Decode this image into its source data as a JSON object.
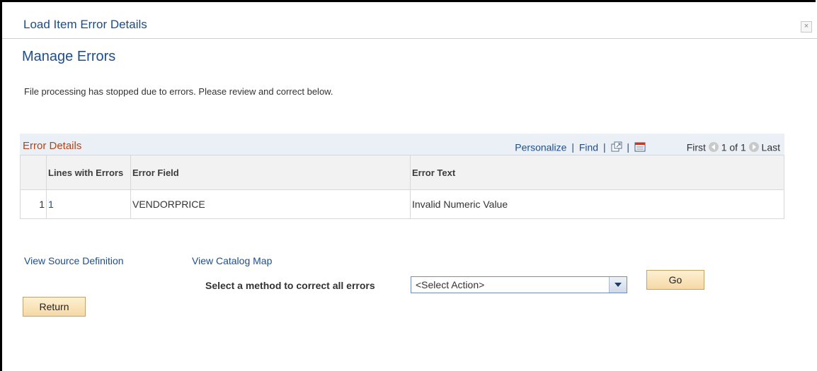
{
  "dialog": {
    "title": "Load Item Error Details",
    "close_label": "×"
  },
  "page": {
    "title": "Manage Errors",
    "message": "File processing has stopped due to errors. Please review and correct below."
  },
  "grid": {
    "title": "Error Details",
    "nav": {
      "personalize": "Personalize",
      "find": "Find",
      "separator": "|",
      "first": "First",
      "range": "1 of 1",
      "last": "Last"
    },
    "columns": [
      "",
      "Lines with Errors",
      "Error Field",
      "Error Text"
    ],
    "rows": [
      {
        "row_num": "1",
        "line": "1",
        "field": "VENDORPRICE",
        "text": "Invalid Numeric Value"
      }
    ]
  },
  "links": {
    "view_source": "View Source Definition",
    "view_catalog": "View Catalog Map"
  },
  "actions": {
    "select_label": "Select a method to correct all errors",
    "select_value": "<Select Action>",
    "go": "Go",
    "return": "Return"
  },
  "colors": {
    "link": "#1f4e8c",
    "grid_title": "#b0451d",
    "button_bg": "#f6d9a5"
  }
}
